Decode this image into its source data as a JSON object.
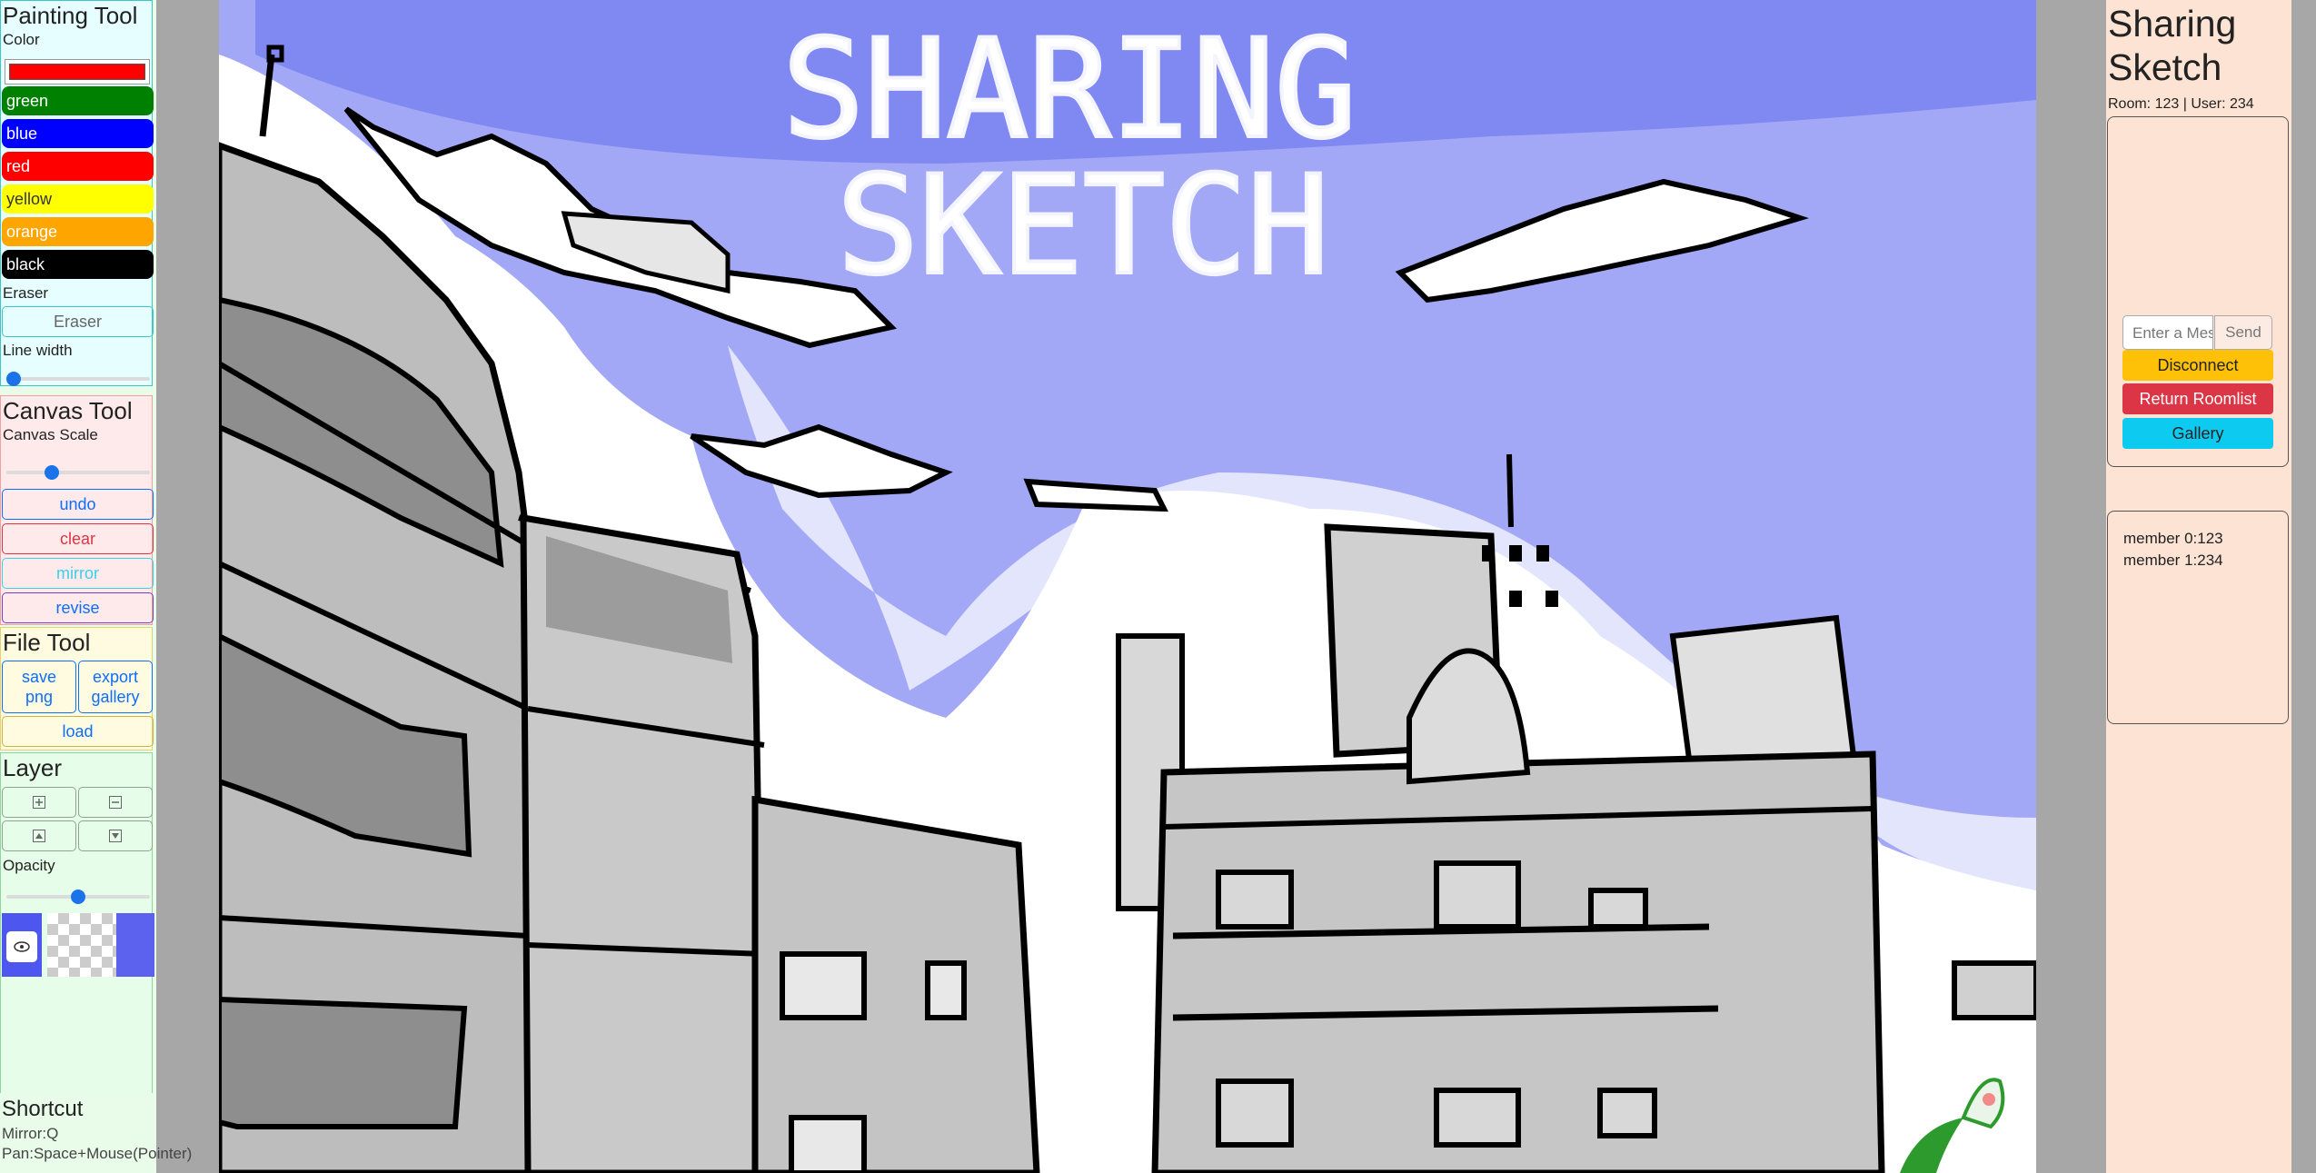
{
  "painting_tool": {
    "title": "Painting Tool",
    "color_label": "Color",
    "current_color": "#ff0000",
    "colors": [
      {
        "label": "green",
        "hex": "#008000"
      },
      {
        "label": "blue",
        "hex": "#0000ff"
      },
      {
        "label": "red",
        "hex": "#ff0000"
      },
      {
        "label": "yellow",
        "hex": "#ffff00"
      },
      {
        "label": "orange",
        "hex": "#ffa500"
      },
      {
        "label": "black",
        "hex": "#000000"
      }
    ],
    "eraser_label": "Eraser",
    "eraser_button": "Eraser",
    "line_width_label": "Line width",
    "line_width": 0.0
  },
  "canvas_tool": {
    "title": "Canvas Tool",
    "scale_label": "Canvas Scale",
    "scale": 0.3,
    "buttons": {
      "undo": "undo",
      "clear": "clear",
      "mirror": "mirror",
      "revise": "revise"
    }
  },
  "file_tool": {
    "title": "File Tool",
    "save_png": "save png",
    "export_gallery": "export gallery",
    "load": "load"
  },
  "layer": {
    "title": "Layer",
    "opacity_label": "Opacity",
    "opacity": 0.5,
    "icons": [
      "plus-icon",
      "minus-icon",
      "up-arrow-icon",
      "down-arrow-icon",
      "eye-icon"
    ]
  },
  "shortcut": {
    "title": "Shortcut",
    "items": [
      "Mirror:Q",
      "Pan:Space+Mouse(Pointer)"
    ]
  },
  "canvas_text": [
    "SHARING",
    "SKETCH"
  ],
  "right_panel": {
    "title": "Sharing Sketch",
    "room_info": "Room: 123 | User: 234",
    "message_placeholder": "Enter a Message",
    "send": "Send",
    "disconnect": "Disconnect",
    "return_roomlist": "Return Roomlist",
    "gallery": "Gallery",
    "members": [
      "member 0:123",
      "member 1:234"
    ]
  },
  "colors": {
    "painting_bg": "#e6feff",
    "canvas_tool_bg": "#feeaea",
    "file_tool_bg": "#fffbe0",
    "layer_bg": "#e6fde9",
    "right_bg": "#fce3d4",
    "sky": "#a2a8f6",
    "disconnect": "#ffc107",
    "return": "#dc3545",
    "gallery": "#0dcaf0"
  }
}
